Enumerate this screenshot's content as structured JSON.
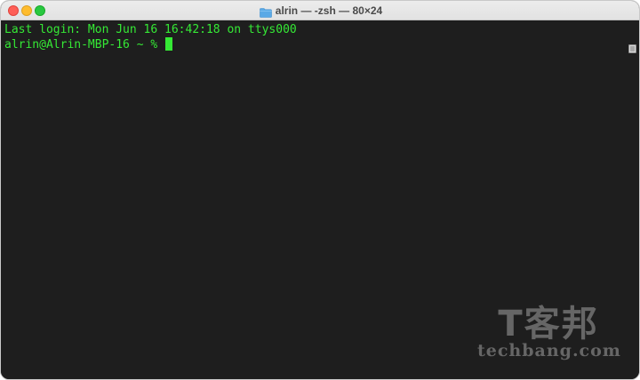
{
  "window": {
    "title": "alrin — -zsh — 80×24",
    "icon": "folder-icon",
    "controls": [
      "close-button",
      "minimize-button",
      "zoom-button"
    ],
    "colors": {
      "background": "#1e1e1e",
      "text": "#35e935",
      "titlebar": "#e6e6e6"
    }
  },
  "terminal": {
    "lines": [
      "Last login: Mon Jun 16 16:42:18 on ttys000"
    ],
    "prompt": "alrin@Alrin-MBP-16 ~ % "
  },
  "watermark": {
    "brand": "T客邦",
    "domain": "techbang.com"
  }
}
